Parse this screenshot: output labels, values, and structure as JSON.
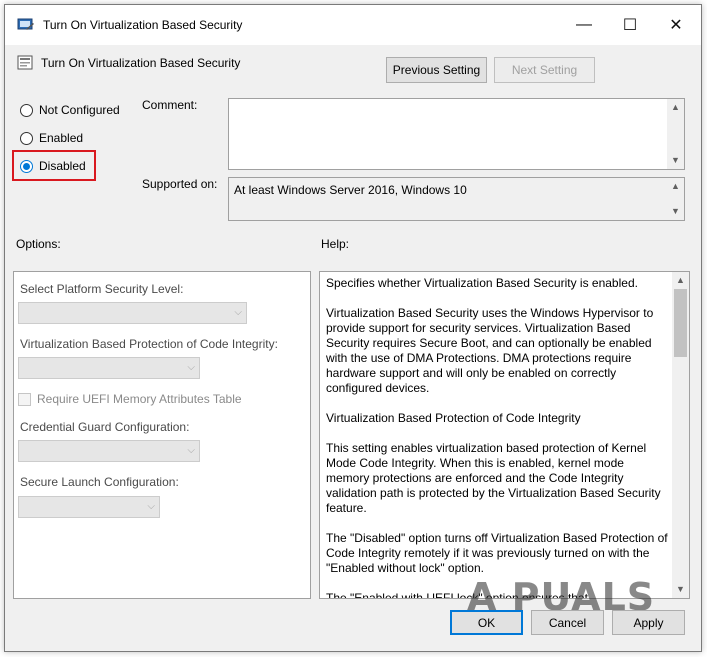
{
  "window": {
    "title": "Turn On Virtualization Based Security",
    "min_glyph": "—",
    "max_glyph": "☐",
    "close_glyph": "✕"
  },
  "header": {
    "setting_name": "Turn On Virtualization Based Security",
    "previous_label": "Previous Setting",
    "next_label": "Next Setting"
  },
  "state": {
    "options": [
      {
        "label": "Not Configured",
        "checked": false
      },
      {
        "label": "Enabled",
        "checked": false
      },
      {
        "label": "Disabled",
        "checked": true
      }
    ],
    "highlight_color": "#d9191f"
  },
  "comment": {
    "label": "Comment:",
    "value": ""
  },
  "supported": {
    "label": "Supported on:",
    "value": "At least Windows Server 2016, Windows 10"
  },
  "options_panel": {
    "heading": "Options:",
    "platform_label": "Select Platform Security Level:",
    "code_integrity_label": "Virtualization Based Protection of Code Integrity:",
    "uefi_checkbox_label": "Require UEFI Memory Attributes Table",
    "credential_guard_label": "Credential Guard Configuration:",
    "secure_launch_label": "Secure Launch Configuration:"
  },
  "help_panel": {
    "heading": "Help:",
    "paragraphs": [
      "Specifies whether Virtualization Based Security is enabled.",
      "Virtualization Based Security uses the Windows Hypervisor to provide support for security services. Virtualization Based Security requires Secure Boot, and can optionally be enabled with the use of DMA Protections. DMA protections require hardware support and will only be enabled on correctly configured devices.",
      "Virtualization Based Protection of Code Integrity",
      "This setting enables virtualization based protection of Kernel Mode Code Integrity. When this is enabled, kernel mode memory protections are enforced and the Code Integrity validation path is protected by the Virtualization Based Security feature.",
      "The \"Disabled\" option turns off Virtualization Based Protection of Code Integrity remotely if it was previously turned on with the \"Enabled without lock\" option.",
      "The \"Enabled with UEFI lock\" option ensures that"
    ]
  },
  "footer": {
    "ok_label": "OK",
    "cancel_label": "Cancel",
    "apply_label": "Apply"
  },
  "watermark": "A PUALS",
  "colors": {
    "accent": "#0078d7",
    "window_bg": "#f0f0f0"
  }
}
